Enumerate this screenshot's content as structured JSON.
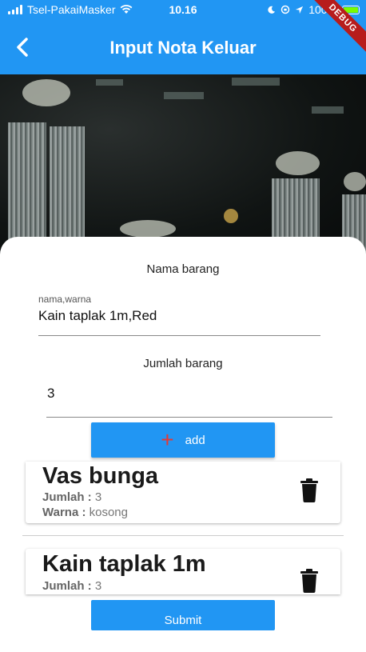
{
  "status_bar": {
    "carrier": "Tsel-PakaiMasker",
    "time": "10.16",
    "battery": "100%"
  },
  "debug_banner": "DEBUG",
  "app_bar": {
    "title": "Input Nota Keluar",
    "back_icon": "chevron-left-icon"
  },
  "form": {
    "nama_label": "Nama barang",
    "nama_caption": "nama,warna",
    "nama_value": "Kain taplak 1m,Red",
    "jumlah_label": "Jumlah barang",
    "jumlah_value": "3",
    "add_label": "add",
    "add_icon": "plus-icon"
  },
  "items": [
    {
      "name": "Vas bunga",
      "jumlah_label": "Jumlah : ",
      "jumlah": "3",
      "warna_label": "Warna : ",
      "warna": "kosong"
    },
    {
      "name": "Kain taplak 1m",
      "jumlah_label": "Jumlah : ",
      "jumlah": "3"
    }
  ],
  "submit_label": "Submit",
  "colors": {
    "primary": "#2196f3",
    "plus": "#e53935",
    "debug": "#b71c1c"
  }
}
